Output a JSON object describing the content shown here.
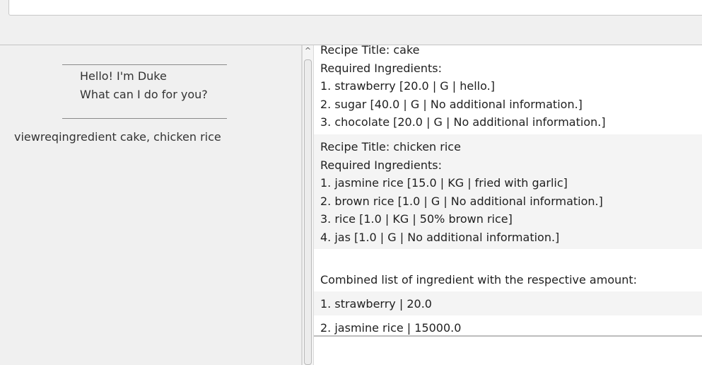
{
  "dialog": {
    "separator": "____________________________",
    "greeting_line1": "Hello! I'm Duke",
    "greeting_line2": "What can I do for you?",
    "user_command": "viewreqingredient cake, chicken rice"
  },
  "scroll": {
    "up_arrow": "^"
  },
  "recipes": [
    {
      "title": "Recipe Title: cake",
      "header": "Required Ingredients:",
      "items": [
        "1.  strawberry [20.0 | G | hello.]",
        "2.  sugar [40.0 | G | No additional information.]",
        "3.  chocolate [20.0 | G | No additional information.]"
      ]
    },
    {
      "title": "Recipe Title: chicken rice",
      "header": "Required Ingredients:",
      "items": [
        "1.  jasmine rice [15.0 | KG | fried with garlic]",
        "2.  brown rice [1.0 | G | No additional information.]",
        "3.  rice [1.0 | KG | 50% brown rice]",
        "4.  jas [1.0 | G | No additional information.]"
      ]
    }
  ],
  "combined": {
    "header": "Combined list of ingredient with the respective amount:",
    "items": [
      "1. strawberry | 20.0",
      "2. jasmine rice | 15000.0"
    ]
  }
}
